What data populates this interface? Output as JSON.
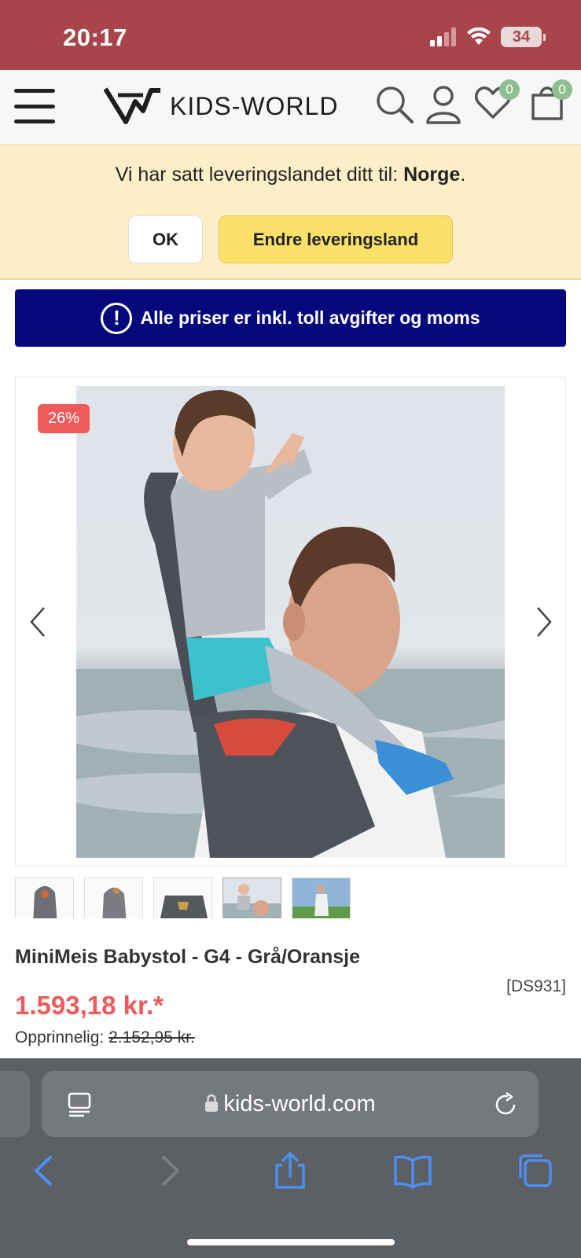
{
  "status_bar": {
    "time": "20:17",
    "battery": "34"
  },
  "header": {
    "logo_text": "KIDS-WORLD",
    "wishlist_count": "0",
    "cart_count": "0"
  },
  "delivery": {
    "message_prefix": "Vi har satt leveringslandet ditt til: ",
    "country": "Norge",
    "message_suffix": ".",
    "ok_label": "OK",
    "change_label": "Endre leveringsland"
  },
  "notice": {
    "text": "Alle priser er inkl. toll avgifter og moms"
  },
  "product": {
    "discount": "26%",
    "title": "MiniMeis Babystol - G4 - Grå/Oransje",
    "sku": "[DS931]",
    "price": "1.593,18 kr.*",
    "original_label": "Opprinnelig: ",
    "original_price": "2.152,95 kr."
  },
  "browser": {
    "url": "kids-world.com"
  },
  "colors": {
    "status_bar": "#a8454a",
    "notice": "#05087d",
    "price": "#ef5a5a",
    "cta": "#fbe06a",
    "banner": "#fcefc8"
  }
}
